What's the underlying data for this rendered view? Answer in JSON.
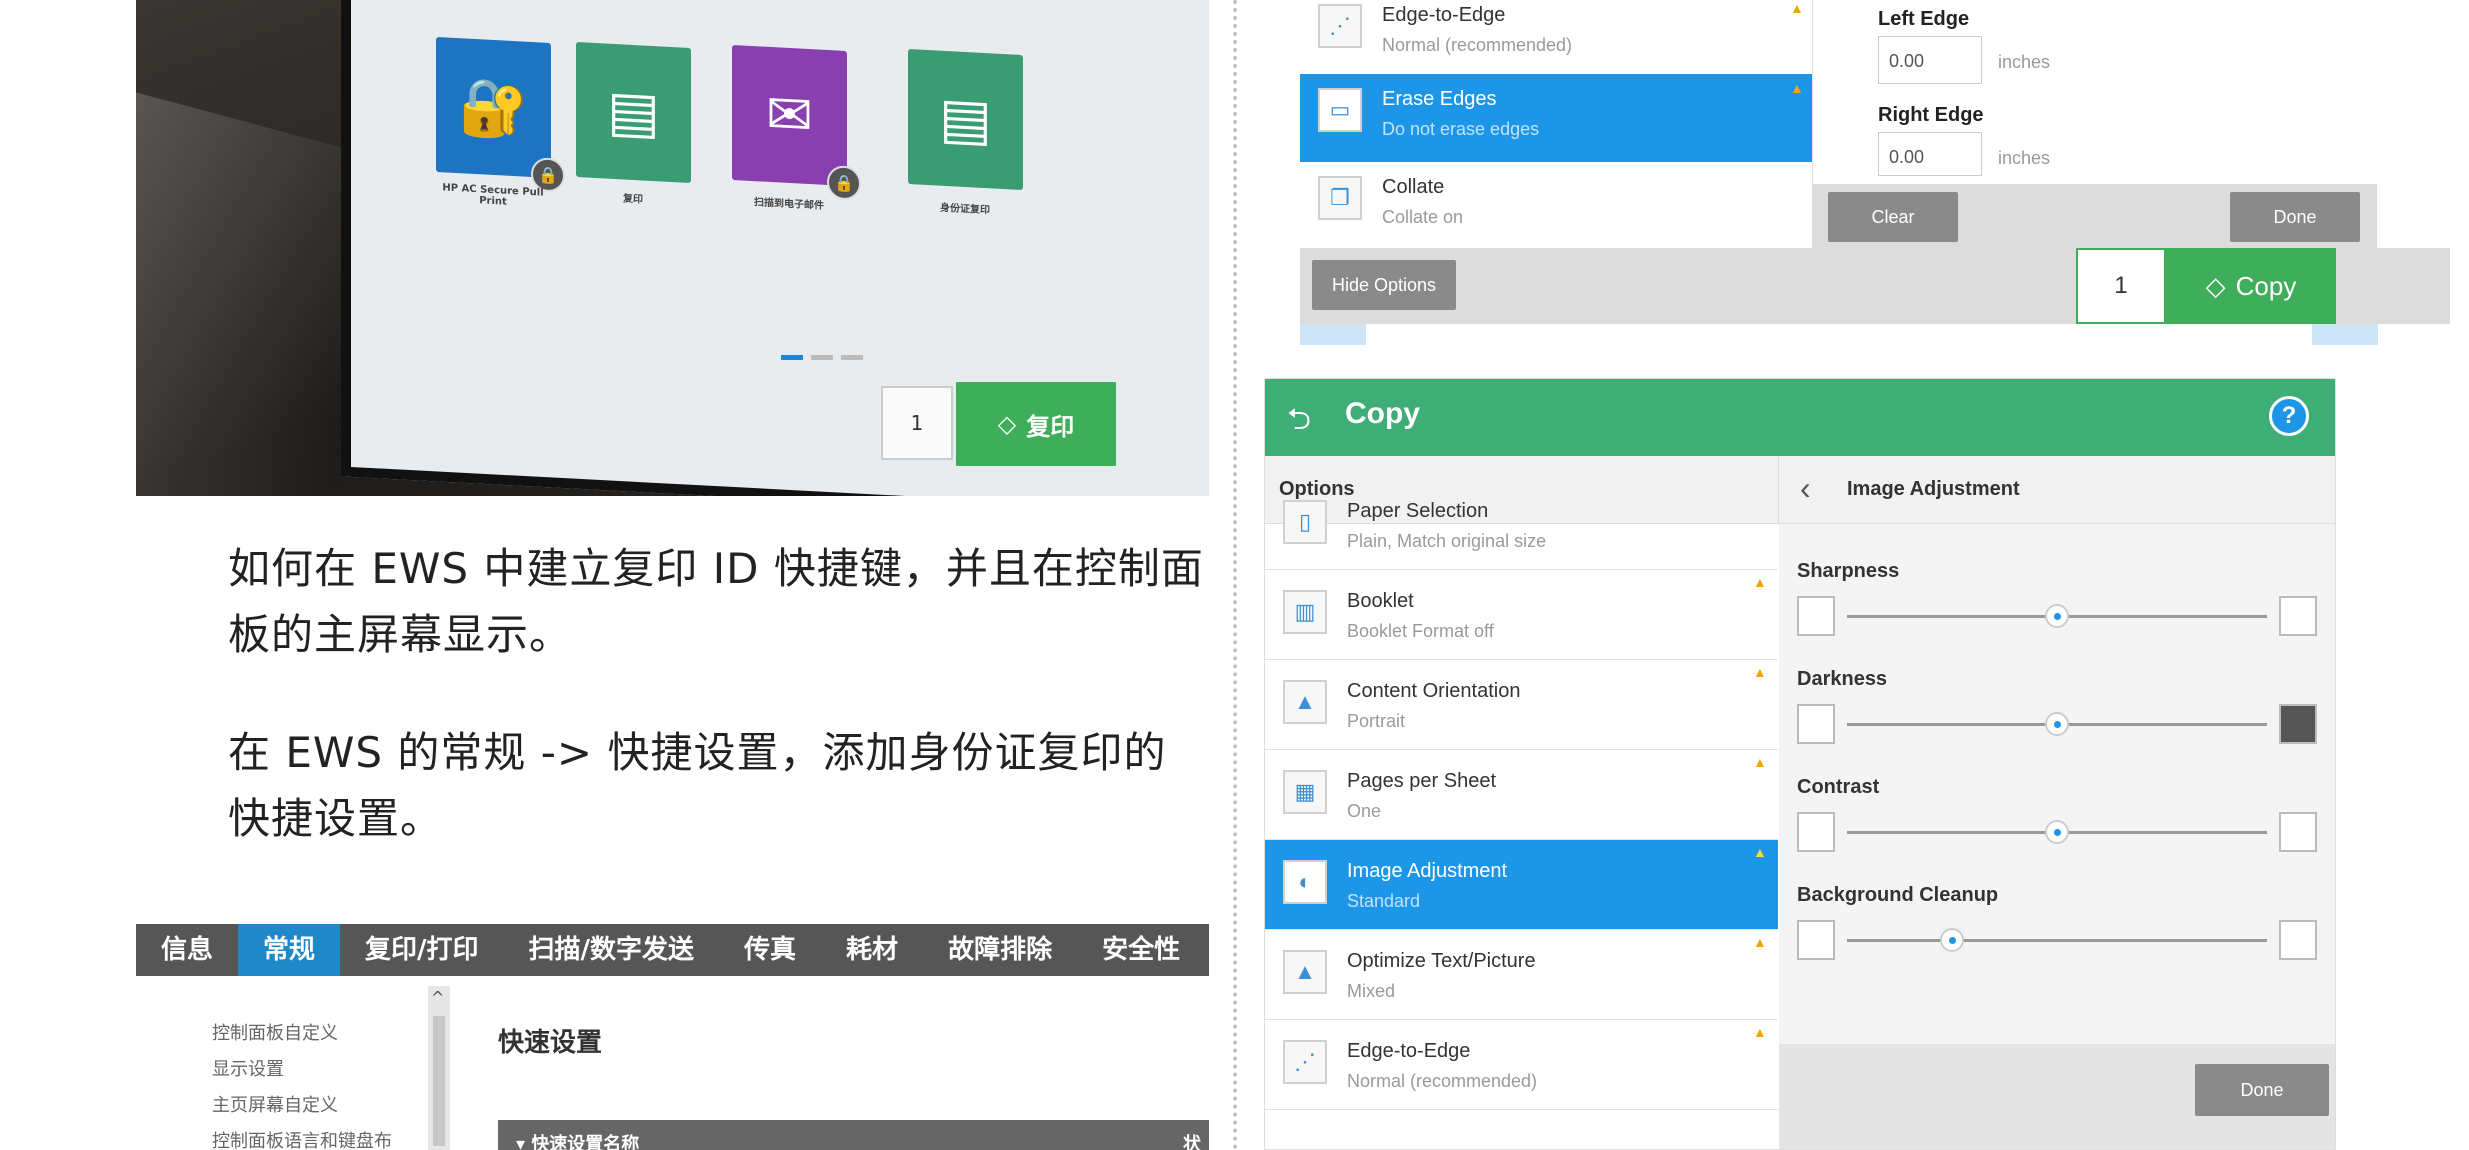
{
  "photo": {
    "tiles": [
      {
        "label": "HP AC Secure Pull Print",
        "color": "#1c74c2",
        "icon": "lock-key-icon"
      },
      {
        "label": "复印",
        "color": "#3a9c73",
        "icon": "copy-icon"
      },
      {
        "label": "扫描到电子邮件",
        "color": "#8a3fb0",
        "icon": "envelope-icon"
      },
      {
        "label": "身份证复印",
        "color": "#3a9c73",
        "icon": "id-copy-icon"
      }
    ],
    "count": "1",
    "copy_label": "复印"
  },
  "paragraphs": {
    "p1": "如何在 EWS 中建立复印 ID 快捷键，并且在控制面板的主屏幕显示。",
    "p2": "在 EWS 的常规 -> 快捷设置，添加身份证复印的快捷设置。"
  },
  "ews": {
    "tabs": [
      "信息",
      "常规",
      "复印/打印",
      "扫描/数字发送",
      "传真",
      "耗材",
      "故障排除",
      "安全性"
    ],
    "active_tab": "常规",
    "sidebar": [
      "控制面板自定义",
      "显示设置",
      "主页屏幕自定义",
      "控制面板语言和键盘布"
    ],
    "page_title": "快速设置",
    "table_header": "快速设置名称",
    "table_header_right": "状"
  },
  "top_panel": {
    "items": [
      {
        "title": "Edge-to-Edge",
        "sub": "Normal (recommended)",
        "icon": "edge-icon",
        "selected": false
      },
      {
        "title": "Erase Edges",
        "sub": "Do not erase edges",
        "icon": "erase-edges-icon",
        "selected": true
      },
      {
        "title": "Collate",
        "sub": "Collate on",
        "icon": "collate-icon",
        "selected": false
      }
    ],
    "left_edge_label": "Left Edge",
    "left_edge_value": "0.00",
    "right_edge_label": "Right Edge",
    "right_edge_value": "0.00",
    "unit": "inches",
    "clear_label": "Clear",
    "done_label": "Done",
    "hide_options_label": "Hide Options",
    "count": "1",
    "copy_label": "Copy"
  },
  "bottom_panel": {
    "title": "Copy",
    "options_label": "Options",
    "detail_title": "Image Adjustment",
    "items": [
      {
        "title": "Paper Selection",
        "sub": "Plain, Match original size",
        "icon": "paper-icon",
        "selected": false
      },
      {
        "title": "Booklet",
        "sub": "Booklet Format off",
        "icon": "booklet-icon",
        "selected": false
      },
      {
        "title": "Content Orientation",
        "sub": "Portrait",
        "icon": "orientation-icon",
        "selected": false
      },
      {
        "title": "Pages per Sheet",
        "sub": "One",
        "icon": "pages-per-sheet-icon",
        "selected": false
      },
      {
        "title": "Image Adjustment",
        "sub": "Standard",
        "icon": "image-adjustment-icon",
        "selected": true
      },
      {
        "title": "Optimize Text/Picture",
        "sub": "Mixed",
        "icon": "optimize-icon",
        "selected": false
      },
      {
        "title": "Edge-to-Edge",
        "sub": "Normal (recommended)",
        "icon": "edge-icon",
        "selected": false
      }
    ],
    "sliders": [
      {
        "label": "Sharpness",
        "value": 0.5
      },
      {
        "label": "Darkness",
        "value": 0.5
      },
      {
        "label": "Contrast",
        "value": 0.5
      },
      {
        "label": "Background Cleanup",
        "value": 0.25
      }
    ],
    "done_label": "Done"
  },
  "colors": {
    "hp_green": "#3fae76",
    "hp_blue": "#1e96e8",
    "ews_blue": "#1e88c8"
  }
}
